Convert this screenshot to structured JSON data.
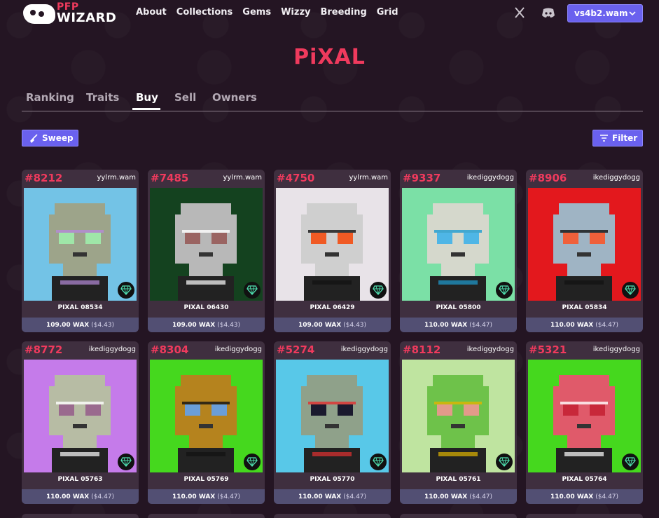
{
  "nav": {
    "logo_top": "PFP",
    "logo_bottom": "WIZARD",
    "links": [
      "About",
      "Collections",
      "Gems",
      "Wizzy",
      "Breeding",
      "Grid"
    ],
    "account": "vs4b2.wam",
    "icons": [
      "x-icon",
      "discord-icon",
      "chevron-down-icon"
    ]
  },
  "page": {
    "title": "PiXAL",
    "tabs": [
      "Ranking",
      "Traits",
      "Buy",
      "Sell",
      "Owners"
    ],
    "active_tab": "Buy",
    "sweep_label": "Sweep",
    "filter_label": "Filter"
  },
  "cards": [
    {
      "rank": "#8212",
      "owner": "yylrm.wam",
      "name": "PIXAL 08534",
      "price": "109.00 WAX",
      "usd": "($4.43)",
      "bg": "#73c3e6",
      "face": "#9da48a",
      "eyes": "#9fe6a8",
      "accent": "#b58ad8"
    },
    {
      "rank": "#7485",
      "owner": "yylrm.wam",
      "name": "PIXAL 06430",
      "price": "109.00 WAX",
      "usd": "($4.43)",
      "bg": "#14421f",
      "face": "#b8b8b8",
      "eyes": "#9a6462",
      "accent": "#ffffff"
    },
    {
      "rank": "#4750",
      "owner": "yylrm.wam",
      "name": "PIXAL 06429",
      "price": "109.00 WAX",
      "usd": "($4.43)",
      "bg": "#e8e3e8",
      "face": "#cfcfcf",
      "eyes": "#f05a24",
      "accent": "#111111"
    },
    {
      "rank": "#9337",
      "owner": "ikediggydogg",
      "name": "PIXAL 05800",
      "price": "110.00 WAX",
      "usd": "($4.47)",
      "bg": "#7be0a6",
      "face": "#d5d8cc",
      "eyes": "#4fb6e6",
      "accent": "#1e9cd1"
    },
    {
      "rank": "#8906",
      "owner": "ikediggydogg",
      "name": "PIXAL 05834",
      "price": "110.00 WAX",
      "usd": "($4.47)",
      "bg": "#e3181d",
      "face": "#9fb4c4",
      "eyes": "#f0603a",
      "accent": "#111111"
    },
    {
      "rank": "#8772",
      "owner": "ikediggydogg",
      "name": "PIXAL 05763",
      "price": "110.00 WAX",
      "usd": "($4.47)",
      "bg": "#c57bea",
      "face": "#b7bca4",
      "eyes": "#9a6a8e",
      "accent": "#ffffff"
    },
    {
      "rank": "#8304",
      "owner": "ikediggydogg",
      "name": "PIXAL 05769",
      "price": "110.00 WAX",
      "usd": "($4.47)",
      "bg": "#45d81e",
      "face": "#b5831e",
      "eyes": "#6a9ed8",
      "accent": "#111111"
    },
    {
      "rank": "#5274",
      "owner": "ikediggydogg",
      "name": "PIXAL 05770",
      "price": "110.00 WAX",
      "usd": "($4.47)",
      "bg": "#58c8e8",
      "face": "#8fa18a",
      "eyes": "#1a1a2e",
      "accent": "#e23030"
    },
    {
      "rank": "#8112",
      "owner": "ikediggydogg",
      "name": "PIXAL 05761",
      "price": "110.00 WAX",
      "usd": "($4.47)",
      "bg": "#bfe4a0",
      "face": "#6ec24a",
      "eyes": "#e29a8a",
      "accent": "#e0b400"
    },
    {
      "rank": "#5321",
      "owner": "ikediggydogg",
      "name": "PIXAL 05764",
      "price": "110.00 WAX",
      "usd": "($4.47)",
      "bg": "#45d81e",
      "face": "#e05a6a",
      "eyes": "#c8283a",
      "accent": "#ffffff"
    }
  ]
}
